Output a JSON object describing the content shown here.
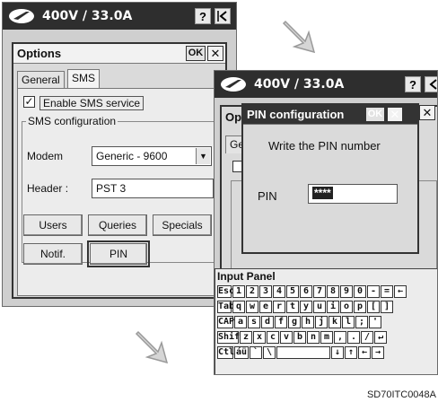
{
  "main_window": {
    "status_title": "400V / 33.0A",
    "help_label": "?"
  },
  "options_dialog": {
    "title": "Options",
    "ok_label": "OK",
    "close_label": "✕",
    "tabs": [
      "General",
      "SMS"
    ],
    "enable_sms": {
      "checked": true,
      "label": "Enable SMS service",
      "check_mark": "✓"
    },
    "group_caption": "SMS configuration",
    "modem": {
      "label": "Modem",
      "value": "Generic - 9600",
      "arrow": "▼"
    },
    "header": {
      "label": "Header :",
      "value": "PST 3"
    },
    "buttons": {
      "users": "Users",
      "queries": "Queries",
      "specials": "Specials",
      "notif": "Notif.",
      "pin": "PIN"
    }
  },
  "second_window": {
    "status_title": "400V / 33.0A",
    "help_label": "?",
    "behind_title_fragment": "Op",
    "behind_tab_fragment": "Ge"
  },
  "pin_dialog": {
    "title": "PIN configuration",
    "ok_label": "OK",
    "close_label": "✕",
    "extra_close_label": "✕",
    "prompt": "Write the PIN number",
    "pin_label": "PIN",
    "pin_value": "****"
  },
  "input_panel": {
    "title": "Input Panel",
    "rows": [
      [
        "Esc",
        "1",
        "2",
        "3",
        "4",
        "5",
        "6",
        "7",
        "8",
        "9",
        "0",
        "-",
        "=",
        "←"
      ],
      [
        "Tab",
        "q",
        "w",
        "e",
        "r",
        "t",
        "y",
        "u",
        "i",
        "o",
        "p",
        "[",
        "]"
      ],
      [
        "CAP",
        "a",
        "s",
        "d",
        "f",
        "g",
        "h",
        "j",
        "k",
        "l",
        ";",
        "'"
      ],
      [
        "Shift",
        "z",
        "x",
        "c",
        "v",
        "b",
        "n",
        "m",
        ",",
        ".",
        "/",
        "↵"
      ],
      [
        "Ctl",
        "áü",
        "`",
        "\\",
        "",
        "↓",
        "↑",
        "←",
        "→"
      ]
    ]
  },
  "figure_code": "SD70ITC0048A"
}
